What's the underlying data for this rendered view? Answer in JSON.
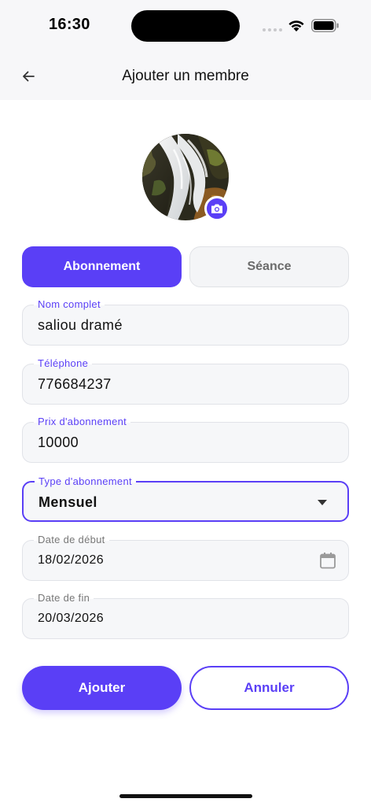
{
  "status_bar": {
    "time": "16:30",
    "signal_icon": "signal-dots-icon",
    "wifi_icon": "wifi-icon",
    "battery_icon": "battery-icon"
  },
  "header": {
    "title": "Ajouter un membre",
    "back_icon": "arrow-left-icon"
  },
  "avatar": {
    "image": "waterfall-photo",
    "camera_icon": "camera-icon"
  },
  "segments": {
    "active_label": "Abonnement",
    "inactive_label": "Séance"
  },
  "form": {
    "name": {
      "label": "Nom complet",
      "value": "saliou dramé"
    },
    "phone": {
      "label": "Téléphone",
      "value": "776684237"
    },
    "price": {
      "label": "Prix d'abonnement",
      "value": "10000"
    },
    "type": {
      "label": "Type d'abonnement",
      "value": "Mensuel",
      "icon": "dropdown-arrow-icon"
    },
    "start_date": {
      "label": "Date de début",
      "value": "18/02/2026",
      "icon": "calendar-icon"
    },
    "end_date": {
      "label": "Date de fin",
      "value": "20/03/2026"
    }
  },
  "actions": {
    "submit_label": "Ajouter",
    "cancel_label": "Annuler"
  },
  "colors": {
    "accent": "#5a3ff6",
    "field_bg": "#f6f7f9",
    "header_bg": "#f7f7f9"
  }
}
